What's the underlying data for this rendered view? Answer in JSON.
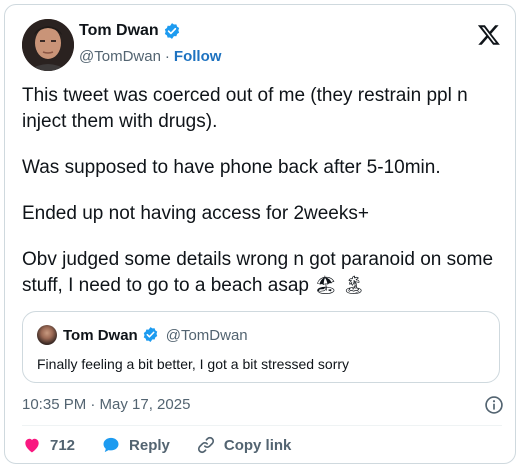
{
  "author": {
    "name": "Tom Dwan",
    "handle": "@TomDwan",
    "separator": "·",
    "follow_label": "Follow"
  },
  "tweet": {
    "paragraphs": [
      "This tweet was coerced out of me (they restrain ppl n inject them with drugs).",
      "Was supposed to have phone back after 5-10min.",
      "Ended up not having access for 2weeks+",
      "Obv judged some details wrong n got paranoid on some stuff, I need to go to a beach asap"
    ],
    "emojis": [
      "🏖",
      "🏝"
    ]
  },
  "quote": {
    "name": "Tom Dwan",
    "handle": "@TomDwan",
    "text": "Finally feeling a bit better, I got a bit stressed sorry"
  },
  "meta": {
    "timestamp": "10:35 PM · May 17, 2025"
  },
  "actions": {
    "likes": "712",
    "reply_label": "Reply",
    "copy_link_label": "Copy link"
  },
  "colors": {
    "accent": "#1d9bf0",
    "follow": "#1d72c0",
    "like": "#f91880",
    "text": "#0f1419",
    "muted": "#536471",
    "border": "#cfd9de"
  },
  "icons": [
    "verified-badge-icon",
    "x-logo-icon",
    "info-icon",
    "heart-icon",
    "reply-bubble-icon",
    "link-icon"
  ]
}
